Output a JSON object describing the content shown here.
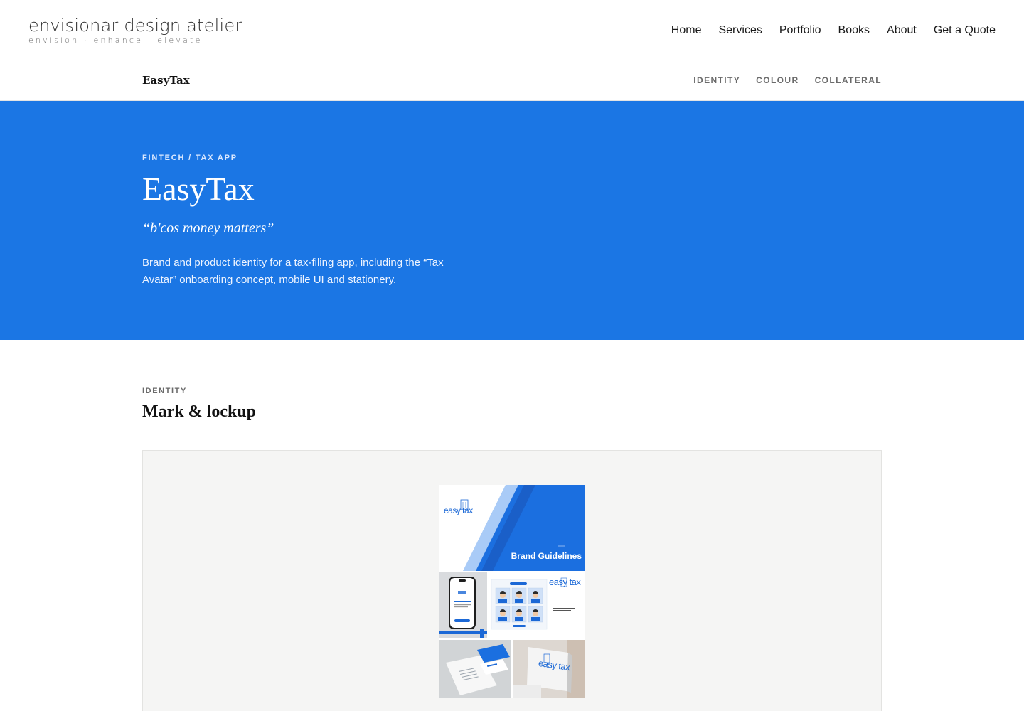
{
  "header": {
    "logo_main": "envisionar design atelier",
    "logo_tagline": "envision · enhance · elevate",
    "nav": [
      "Home",
      "Services",
      "Portfolio",
      "Books",
      "About",
      "Get a Quote"
    ]
  },
  "subnav": {
    "project": "EasyTax",
    "links": [
      "IDENTITY",
      "COLOUR",
      "COLLATERAL"
    ]
  },
  "hero": {
    "kicker": "FINTECH / TAX APP",
    "title": "EasyTax",
    "tagline": "“b'cos money matters”",
    "description": "Brand and product identity for a tax-filing app, including the “Tax Avatar” onboarding concept, mobile UI and stationery."
  },
  "identity": {
    "kicker": "IDENTITY",
    "title": "Mark & lockup"
  },
  "collage": {
    "cover_logo": "easy tax",
    "cover_title": "Brand Guidelines",
    "ui_logo": "easy tax",
    "sign_logo": "easy tax"
  },
  "colors": {
    "brand_blue": "#1b76e4",
    "light_blue": "#a9cbf7"
  }
}
